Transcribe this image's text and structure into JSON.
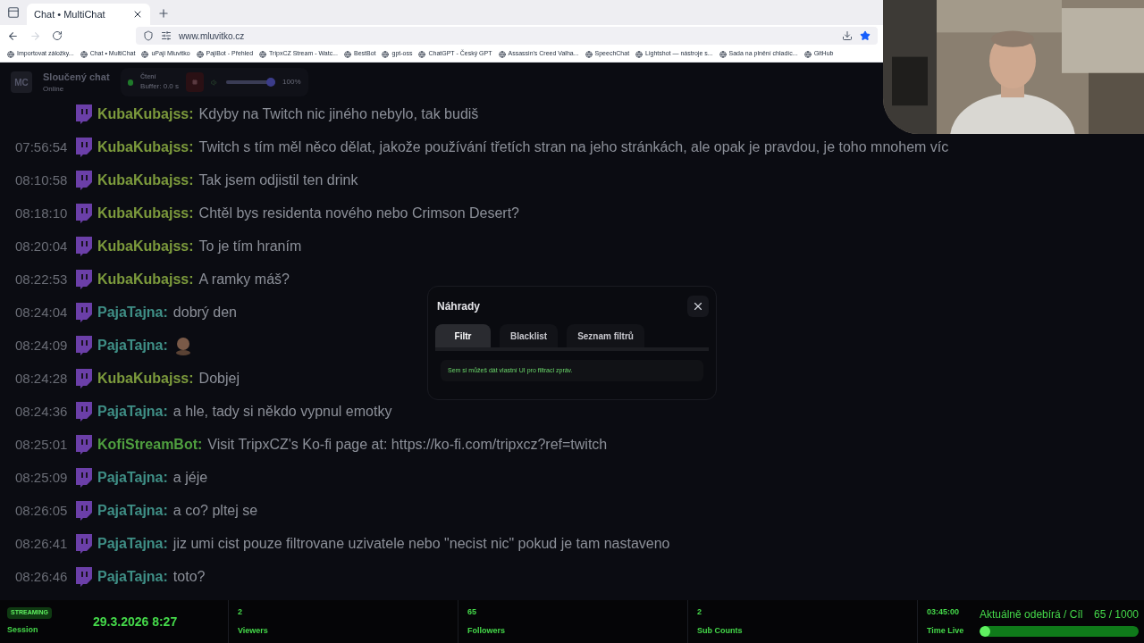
{
  "browser": {
    "tab": {
      "title": "Chat • MultiChat",
      "selected": true
    },
    "url": "www.mluvitko.cz",
    "bookmarks": [
      "Importovat záložky...",
      "Chat • MultiChat",
      "uPaji Mluvitko",
      "PajiBot - Přehled",
      "TripxCZ Stream - Watc...",
      "BestBot",
      "gpt-oss",
      "ChatGPT - Český GPT",
      "Assassin's Creed Valha...",
      "SpeechChat",
      "Lightshot — nástroje s...",
      "Sada na plnění chladíc...",
      "GitHub"
    ]
  },
  "header": {
    "avatar": "MC",
    "title": "Sloučený chat",
    "status": "Online",
    "reader": {
      "label": "Čtení",
      "buffer": "Buffer: 0.0 s",
      "on": true
    },
    "volume": {
      "level": 1,
      "reading": "100%"
    }
  },
  "messages": [
    {
      "user": "KubaKubajss:",
      "color": "#7c9a3c",
      "text": "Kdyby na Twitch nic jiného nebylo, tak budiš"
    },
    {
      "time": "07:56:54",
      "user": "KubaKubajss:",
      "color": "#7c9a3c",
      "text": "Twitch s tím měl něco dělat, jakože používání třetích stran na jeho stránkách, ale opak je pravdou, je toho mnohem víc"
    },
    {
      "time": "08:10:58",
      "user": "KubaKubajss:",
      "color": "#7c9a3c",
      "text": "Tak jsem odjistil ten drink"
    },
    {
      "time": "08:18:10",
      "user": "KubaKubajss:",
      "color": "#7c9a3c",
      "text": "Chtěl bys residenta nového nebo Crimson Desert?"
    },
    {
      "time": "08:20:04",
      "user": "KubaKubajss:",
      "color": "#7c9a3c",
      "text": "To je tím hraním"
    },
    {
      "time": "08:22:53",
      "user": "KubaKubajss:",
      "color": "#7c9a3c",
      "text": "A ramky máš?"
    },
    {
      "time": "08:24:04",
      "user": "PajaTajna:",
      "color": "#3f8f86",
      "text": "dobrý den"
    },
    {
      "time": "08:24:09",
      "user": "PajaTajna:",
      "color": "#3f8f86",
      "kind": "emote"
    },
    {
      "time": "08:24:28",
      "user": "KubaKubajss:",
      "color": "#7c9a3c",
      "text": "Dobjej"
    },
    {
      "time": "08:24:36",
      "user": "PajaTajna:",
      "color": "#3f8f86",
      "text": "a hle, tady si někdo vypnul emotky"
    },
    {
      "time": "08:25:01",
      "user": "KofiStreamBot:",
      "color": "#4f9f3f",
      "text": "Visit TripxCZ's Ko-fi page at: https://ko-fi.com/tripxcz?ref=twitch"
    },
    {
      "time": "08:25:09",
      "user": "PajaTajna:",
      "color": "#3f8f86",
      "text": "a jéje"
    },
    {
      "time": "08:26:05",
      "user": "PajaTajna:",
      "color": "#3f8f86",
      "text": "a co? pltej se"
    },
    {
      "time": "08:26:41",
      "user": "PajaTajna:",
      "color": "#3f8f86",
      "text": "jiz umi cist pouze filtrovane uzivatele nebo \"necist nic\" pokud je tam nastaveno"
    },
    {
      "time": "08:26:46",
      "user": "PajaTajna:",
      "color": "#3f8f86",
      "text": "toto?"
    }
  ],
  "dialog": {
    "title": "Náhrady",
    "tabs": [
      {
        "label": "Filtr",
        "selected": true
      },
      {
        "label": "Blacklist",
        "selected": false
      },
      {
        "label": "Seznam filtrů",
        "selected": false
      }
    ],
    "body": "Sem si můžeš dát vlastní UI pro filtraci zpráv."
  },
  "status_bar": {
    "badge": "STREAMING",
    "session": "Session",
    "datetime": "29.3.2026 8:27",
    "stats": [
      {
        "value": "2",
        "label": "Viewers"
      },
      {
        "value": "65",
        "label": "Followers"
      },
      {
        "value": "2",
        "label": "Sub Counts"
      }
    ],
    "time_live": {
      "value": "03:45:00",
      "label": "Time Live"
    },
    "goal": {
      "label": "Aktuálně odebírá / Cíl",
      "count": "65 / 1000",
      "level": 0.065
    }
  }
}
